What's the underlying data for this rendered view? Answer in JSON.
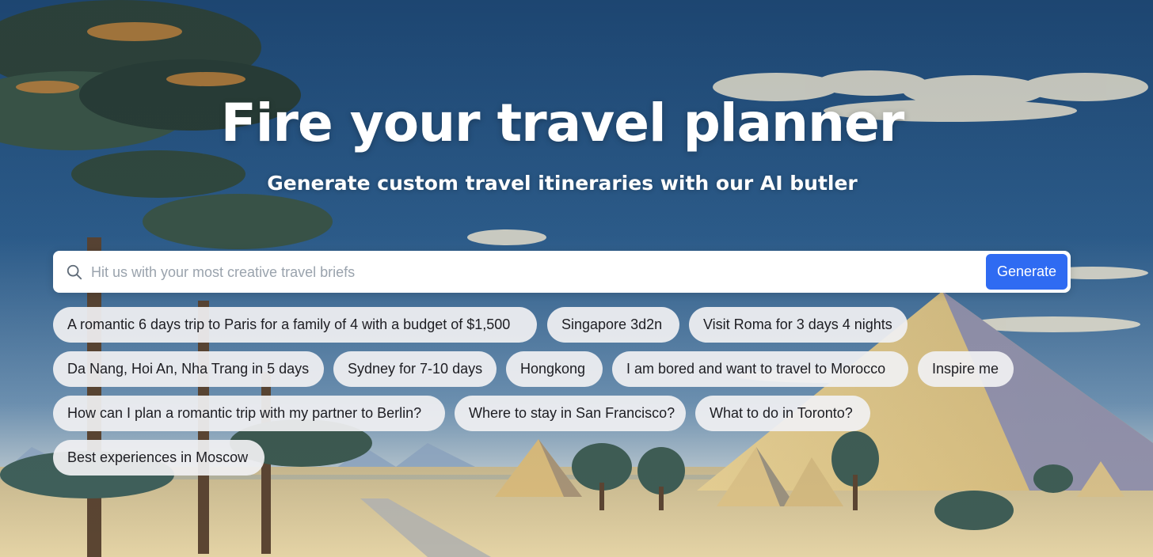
{
  "hero": {
    "title": "Fire your travel planner",
    "subtitle": "Generate custom travel itineraries with our AI butler"
  },
  "search": {
    "placeholder": "Hit us with your most creative travel briefs",
    "value": "",
    "icon": "search-icon",
    "button_label": "Generate",
    "button_color": "#2f6bf2"
  },
  "suggestions": [
    "A romantic 6 days trip to Paris for a family of 4 with a budget of $1,500",
    "Singapore 3d2n",
    "Visit Roma for 3 days 4 nights",
    "Da Nang, Hoi An, Nha Trang in 5 days",
    "Sydney for 7-10 days",
    "Hongkong",
    "I am bored and want to travel to Morocco",
    "Inspire me",
    "How can I plan a romantic trip with my partner to Berlin?",
    "Where to stay in San Francisco?",
    "What to do in Toronto?",
    "Best experiences in Moscow"
  ],
  "colors": {
    "sky": "#2b5a86",
    "desert": "#d9c79a",
    "chip_bg": "#f0f0f2",
    "accent": "#2f6bf2"
  }
}
